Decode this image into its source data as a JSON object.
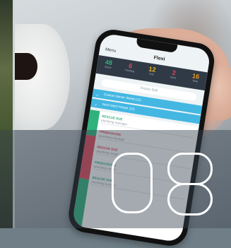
{
  "app": {
    "title": "Flexi",
    "header_left": "Menu",
    "search_placeholder": "Rotary Ball"
  },
  "stats": [
    {
      "value": "48",
      "label": "Active",
      "color": "#2fb27b"
    },
    {
      "value": "6",
      "label": "Pending",
      "color": "#e0455a"
    },
    {
      "value": "12",
      "label": "Due",
      "color": "#f2b51b"
    },
    {
      "value": "2",
      "label": "Done",
      "color": "#e0455a"
    },
    {
      "value": "16",
      "label": "Total",
      "color": "#f29a1b"
    }
  ],
  "rows": [
    {
      "label": "Custom Server Shield (12)"
    },
    {
      "label": "Nest Hatch Range (10)"
    }
  ],
  "list_items": [
    {
      "name": "RESCUE DUE",
      "sub": "plumbing manager",
      "tone": "green"
    },
    {
      "name": "PREBOOKING",
      "sub": "plumbing manager",
      "tone": "red"
    },
    {
      "name": "RESCUE DUE",
      "sub": "plumbing repair",
      "tone": "red"
    },
    {
      "name": "PREBOOKING",
      "sub": "plumbing repair",
      "tone": "green"
    },
    {
      "name": "RESCUE DUE",
      "sub": "plumbing support",
      "tone": "green"
    }
  ],
  "slide_number": "08"
}
